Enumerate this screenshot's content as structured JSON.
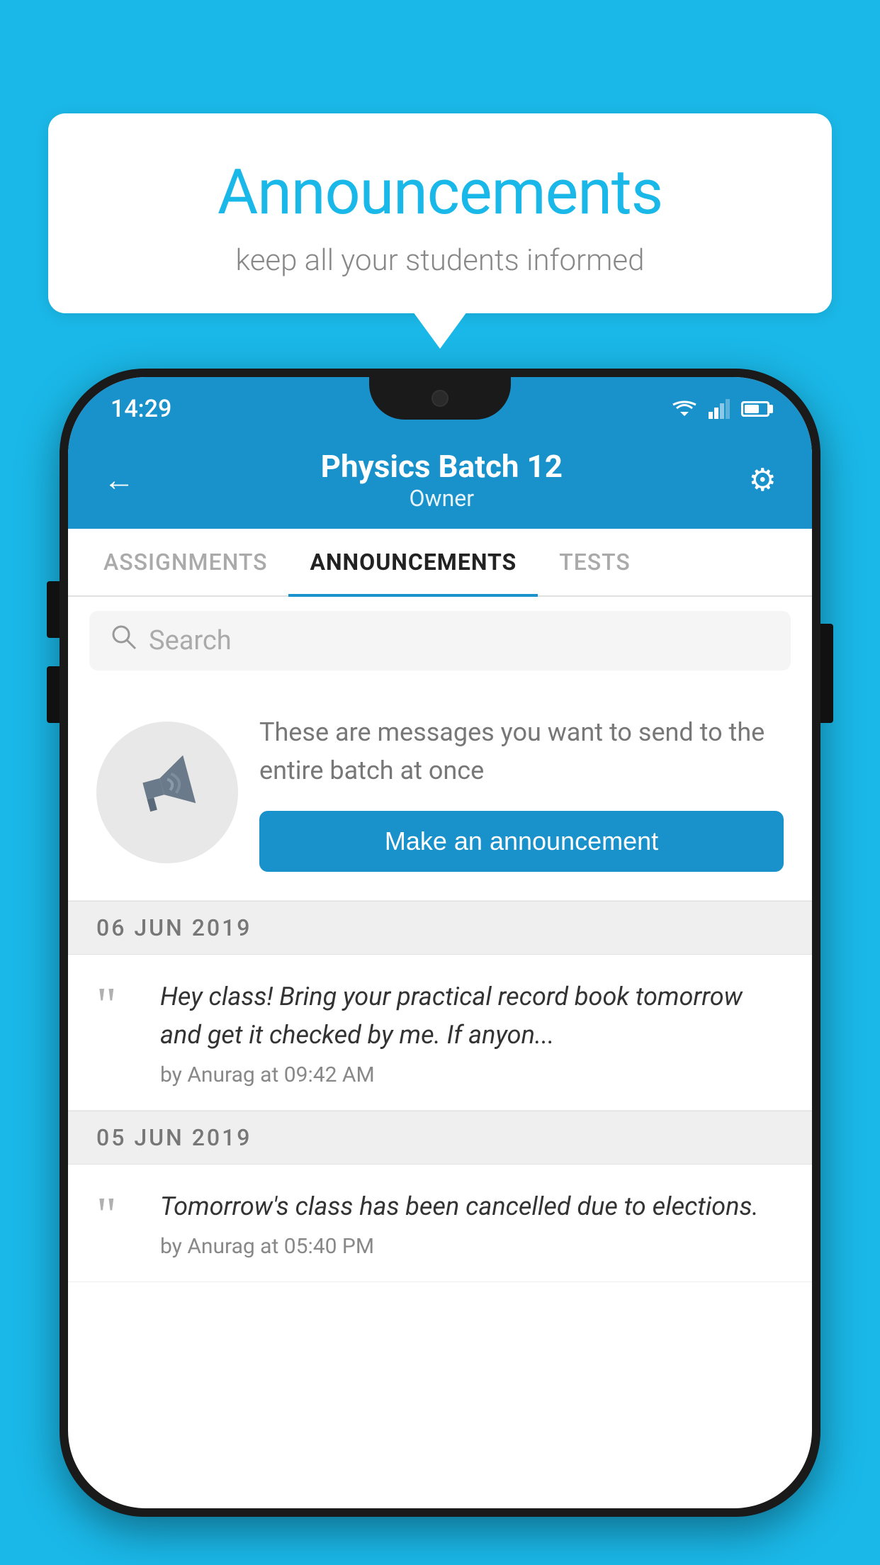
{
  "background_color": "#1ab8e8",
  "speech_bubble": {
    "title": "Announcements",
    "subtitle": "keep all your students informed"
  },
  "phone": {
    "status_bar": {
      "time": "14:29"
    },
    "header": {
      "back_label": "←",
      "title": "Physics Batch 12",
      "subtitle": "Owner",
      "gear_label": "⚙"
    },
    "tabs": [
      {
        "label": "ASSIGNMENTS",
        "active": false
      },
      {
        "label": "ANNOUNCEMENTS",
        "active": true
      },
      {
        "label": "TESTS",
        "active": false
      }
    ],
    "search": {
      "placeholder": "Search"
    },
    "promo": {
      "description": "These are messages you want to send to the entire batch at once",
      "button_label": "Make an announcement"
    },
    "announcements": [
      {
        "date": "06  JUN  2019",
        "text": "Hey class! Bring your practical record book tomorrow and get it checked by me. If anyon...",
        "meta": "by Anurag at 09:42 AM"
      },
      {
        "date": "05  JUN  2019",
        "text": "Tomorrow's class has been cancelled due to elections.",
        "meta": "by Anurag at 05:40 PM"
      }
    ]
  }
}
